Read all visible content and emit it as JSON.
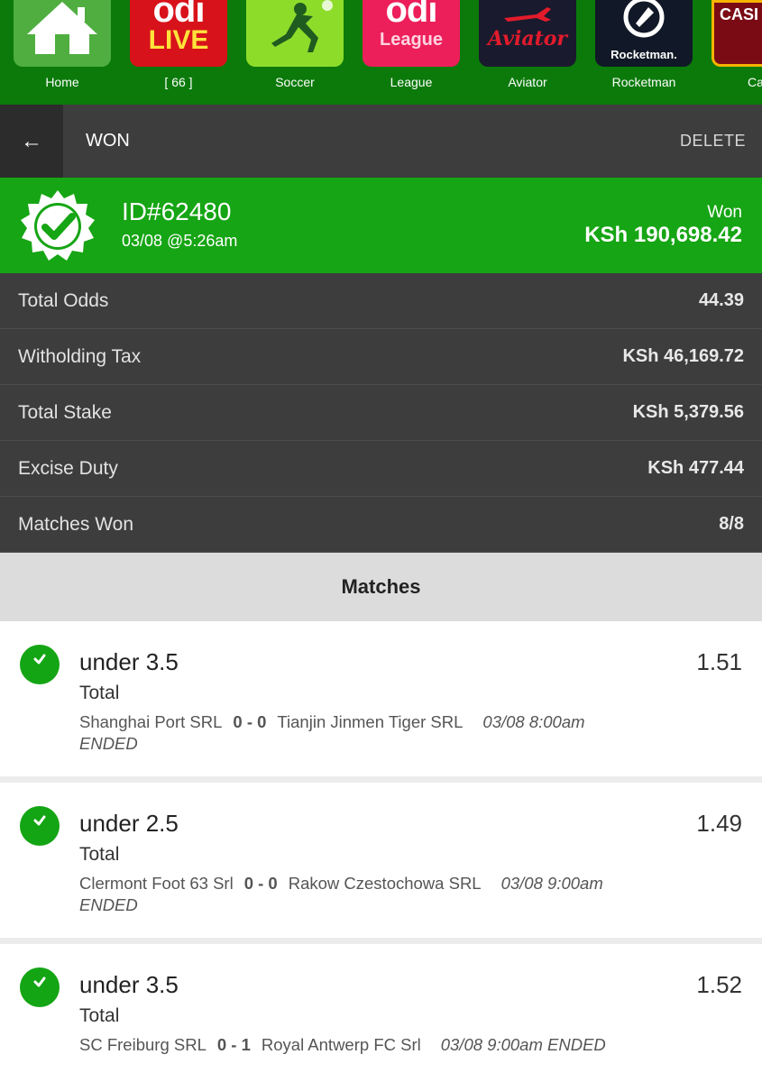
{
  "categories": [
    {
      "label": "Home",
      "icon": "home-icon"
    },
    {
      "label": "[ 66 ]",
      "tile_top": "odi",
      "tile_bottom": "LIVE"
    },
    {
      "label": "Soccer",
      "icon": "soccer-player-icon"
    },
    {
      "label": "League",
      "tile_top": "odi",
      "tile_bottom": "League"
    },
    {
      "label": "Aviator",
      "tile_text": "Aviator"
    },
    {
      "label": "Rocketman",
      "tile_text": "Rocketman."
    },
    {
      "label": "Casi",
      "tile_text": "CASI DIRE"
    }
  ],
  "header": {
    "back_icon": "arrow-left-icon",
    "back_glyph": "←",
    "title": "WON",
    "delete_label": "DELETE"
  },
  "bet": {
    "id": "ID#62480",
    "date": "03/08 @5:26am",
    "status": "Won",
    "amount": "KSh 190,698.42",
    "accent": "#16a514"
  },
  "stats": [
    {
      "label": "Total Odds",
      "value": "44.39"
    },
    {
      "label": "Witholding Tax",
      "value": "KSh 46,169.72"
    },
    {
      "label": "Total Stake",
      "value": "KSh 5,379.56"
    },
    {
      "label": "Excise Duty",
      "value": "KSh 477.44"
    },
    {
      "label": "Matches Won",
      "value": "8/8"
    }
  ],
  "matches_heading": "Matches",
  "matches": [
    {
      "pick": "under 3.5",
      "market": "Total",
      "odds": "1.51",
      "home": "Shanghai Port SRL",
      "score": "0 - 0",
      "away": "Tianjin Jinmen Tiger SRL",
      "when": "03/08 8:00am",
      "state": "ENDED"
    },
    {
      "pick": "under 2.5",
      "market": "Total",
      "odds": "1.49",
      "home": "Clermont Foot 63 Srl",
      "score": "0 - 0",
      "away": "Rakow Czestochowa SRL",
      "when": "03/08 9:00am",
      "state": "ENDED"
    },
    {
      "pick": "under 3.5",
      "market": "Total",
      "odds": "1.52",
      "home": "SC Freiburg SRL",
      "score": "0 - 1",
      "away": "Royal Antwerp FC Srl",
      "when": "03/08 9:00am",
      "state": "ENDED"
    }
  ]
}
